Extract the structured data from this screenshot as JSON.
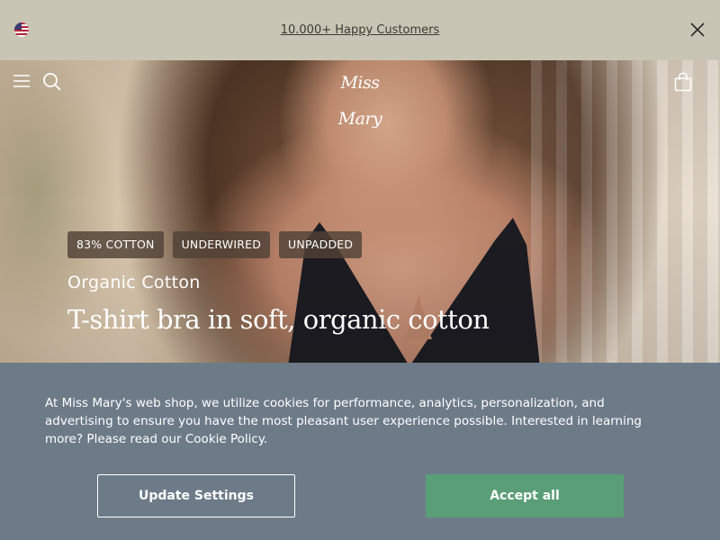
{
  "announcement": {
    "text": "10.000+ Happy Customers",
    "flag_icon": "us-flag-icon",
    "close_icon": "close-icon"
  },
  "header": {
    "logo": "Miss Mary",
    "menu_icon": "hamburger-menu-icon",
    "search_icon": "search-icon",
    "bag_icon": "shopping-bag-icon"
  },
  "hero": {
    "tags": [
      "83% COTTON",
      "UNDERWIRED",
      "UNPADDED"
    ],
    "eyebrow": "Organic Cotton",
    "headline": "T-shirt bra in soft, organic cotton"
  },
  "cookie_banner": {
    "text": "At Miss Mary's web shop, we utilize cookies for performance, analytics, personalization, and advertising to ensure you have the most pleasant user experience possible. Interested in learning more? Please read our Cookie Policy.",
    "settings_label": "Update Settings",
    "accept_label": "Accept all"
  },
  "colors": {
    "announcement_bg": "#c9c5b4",
    "cookie_bg": "#6d7b88",
    "accept_button": "#5a9e78",
    "tag_bg": "#504237"
  }
}
